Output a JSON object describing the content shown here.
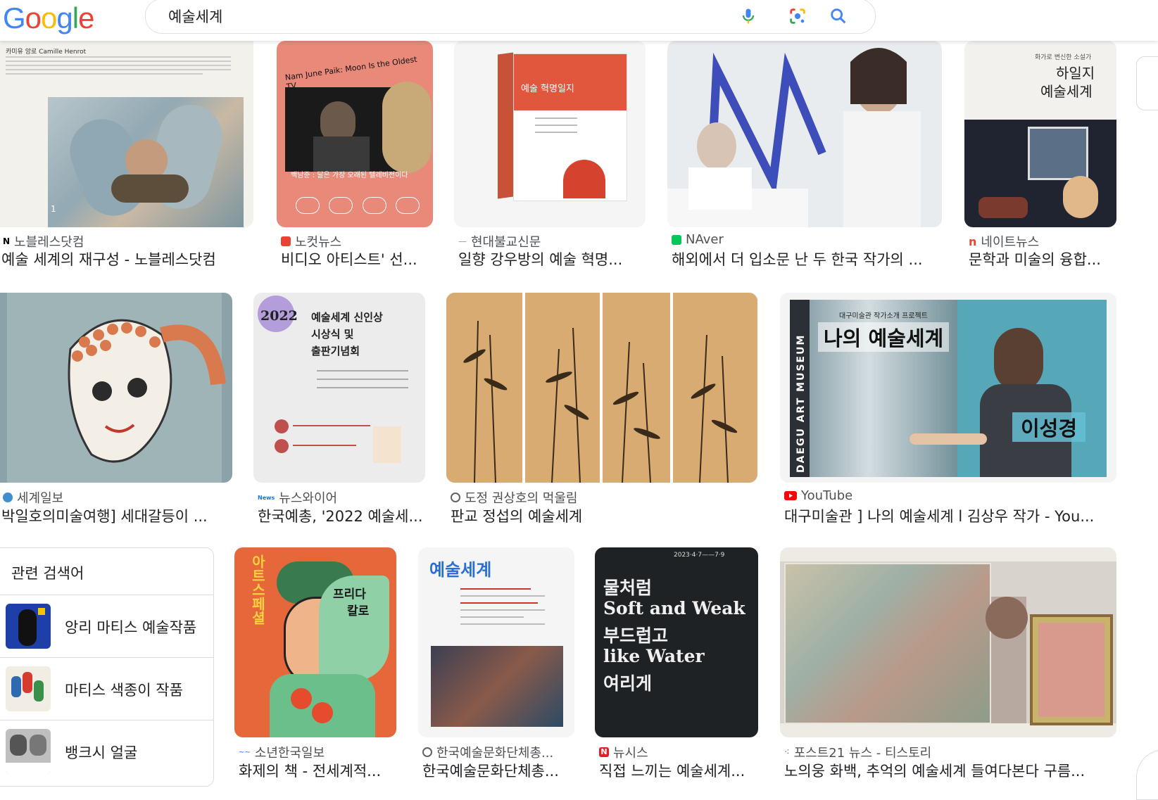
{
  "search": {
    "query": "예술세계"
  },
  "logo": {
    "letters": [
      "G",
      "o",
      "o",
      "g",
      "l",
      "e"
    ]
  },
  "row1": [
    {
      "source": "노블레스닷컴",
      "title": "예술 세계의 재구성 - 노블레스닷컴",
      "img_caption": "카미유 앙로 Camille Henrot",
      "img_num": "1"
    },
    {
      "source": "노컷뉴스",
      "title": "비디오 아티스트' 선...",
      "img_text": "Nam June Paik: Moon Is the Oldest TV",
      "img_sub": "백남준 : 달은 가장 오래된 텔레비전이다"
    },
    {
      "source": "현대불교신문",
      "title": "일향 강우방의 예술 혁명...",
      "img_text": "예술 혁명일지"
    },
    {
      "source": "NAver",
      "title": "해외에서 더 입소문 난 두 한국 작가의 ..."
    },
    {
      "source": "네이트뉴스",
      "title": "문학과 미술의 융합...",
      "img_text1": "하일지",
      "img_text2": "예술세계",
      "img_top": "화가로 변신한 소설가"
    }
  ],
  "row2": [
    {
      "source": "세계일보",
      "title": "박일호의미술여행] 세대갈등이 ..."
    },
    {
      "source": "뉴스와이어",
      "title": "한국예총, '2022 예술세...",
      "img_year": "2022",
      "img_line1": "예술세계 신인상",
      "img_line2": "시상식 및",
      "img_line3": "출판기념회"
    },
    {
      "source": "도정 권상호의 먹울림",
      "title": "판교 정섭의 예술세계"
    },
    {
      "source": "YouTube",
      "title": "대구미술관 ] 나의 예술세계 l 김상우 작가 - You...",
      "img_top": "대구미술관 작가소개 프로젝트",
      "img_main": "나의 예술세계",
      "img_name": "이성경",
      "img_side": "DAEGU ART MUSEUM"
    }
  ],
  "related": {
    "heading": "관련 검색어",
    "items": [
      {
        "label": "앙리 마티스 예술작품"
      },
      {
        "label": "마티스 색종이 작품"
      },
      {
        "label": "뱅크시 얼굴"
      }
    ]
  },
  "row3": [
    {
      "source": "소년한국일보",
      "title": "화제의 책 - 전세계적...",
      "img_v": "아트스페셜",
      "img_name1": "프리다",
      "img_name2": "칼로"
    },
    {
      "source": "한국예술문화단체총...",
      "title": "한국예술문화단체총...",
      "img_head": "예술세계"
    },
    {
      "source": "뉴시스",
      "title": "직접 느끼는 예술세계...",
      "img_date": "2023·4·7——7·9",
      "img_l1": "물처럼",
      "img_l2": "Soft and Weak",
      "img_l3": "부드럽고",
      "img_l4": "like Water",
      "img_l5": "여리게"
    },
    {
      "source": "포스트21 뉴스 - 티스토리",
      "title": "노의웅 화백, 추억의 예술세계 들여다본다 구름..."
    }
  ],
  "colors": {
    "google_blue": "#4285f4",
    "google_red": "#ea4335",
    "google_yellow": "#fbbc05",
    "google_green": "#34a853",
    "mic": "#4285f4"
  },
  "icons": [
    "microphone-icon",
    "google-lens-icon",
    "search-icon"
  ]
}
